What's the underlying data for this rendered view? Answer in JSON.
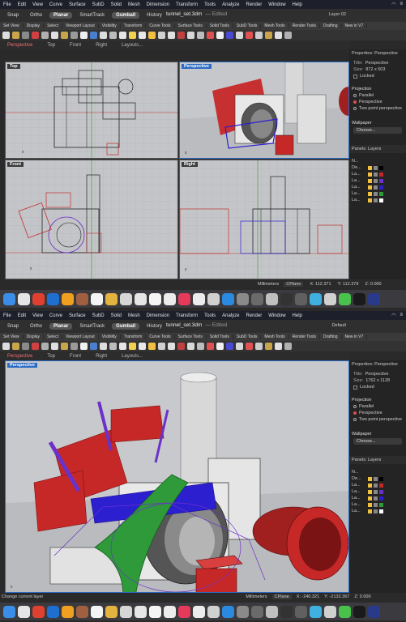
{
  "menu": [
    "File",
    "Edit",
    "View",
    "Curve",
    "Surface",
    "SubD",
    "Solid",
    "Mesh",
    "Dimension",
    "Transform",
    "Tools",
    "Analyze",
    "Render",
    "Window",
    "Help"
  ],
  "doc": {
    "title": "tunnel_set.3dm",
    "edited": "— Edited"
  },
  "top_title_bar": {
    "buttons": [
      "Snap",
      "Ortho",
      "Planar",
      "SmartTrack",
      "Gumball",
      "History"
    ],
    "active": [
      "Planar",
      "Gumball"
    ],
    "layer_top": "Layer 02",
    "layer_bottom": "Default"
  },
  "tabs": [
    "Set View",
    "Display",
    "Select",
    "Viewport Layout",
    "Visibility",
    "Transform",
    "Curve Tools",
    "Surface Tools",
    "Solid Tools",
    "SubD Tools",
    "Mesh Tools",
    "Render Tools",
    "Drafting",
    "New in V7"
  ],
  "viewport_tabs": [
    "Perspective",
    "Top",
    "Front",
    "Right",
    "Layouts..."
  ],
  "viewports_top": [
    "Top",
    "Perspective",
    "Front",
    "Right"
  ],
  "viewport_bottom": "Perspective",
  "panel": {
    "properties_label": "Properties: Perspective",
    "title_key": "Title:",
    "title_val": "Perspective",
    "size_key": "Size:",
    "size_top": "872 x 503",
    "size_bottom": "1762 x 1128",
    "locked": "Locked",
    "projection": "Projection",
    "proj_options": [
      "Parallel",
      "Perspective",
      "Two point perspective"
    ],
    "wallpaper": "Wallpaper",
    "choose": "Choose...",
    "layers_label": "Panels: Layers",
    "layer_header": "N...",
    "layers_top": [
      "De...",
      "La...",
      "La...",
      "La...",
      "La...",
      "La..."
    ],
    "layers_bottom": [
      "De...",
      "La...",
      "La...",
      "La...",
      "La...",
      "La..."
    ]
  },
  "status_top": {
    "units": "Millimeters",
    "plane": "CPlane",
    "x": "X: 112.371",
    "y": "Y: 112.379",
    "z": "Z: 0.000"
  },
  "status_bottom": {
    "units": "Millimeters",
    "plane": "CPlane",
    "x": "X: -240.321",
    "y": "Y: -2132.367",
    "z": "Z: 0.000",
    "hint": "Change current layer"
  },
  "colors": {
    "red": "#c62828",
    "blue": "#2c1fd0",
    "green": "#2e9a3a",
    "purple": "#6a32c8",
    "accent": "#2b6bc4"
  }
}
